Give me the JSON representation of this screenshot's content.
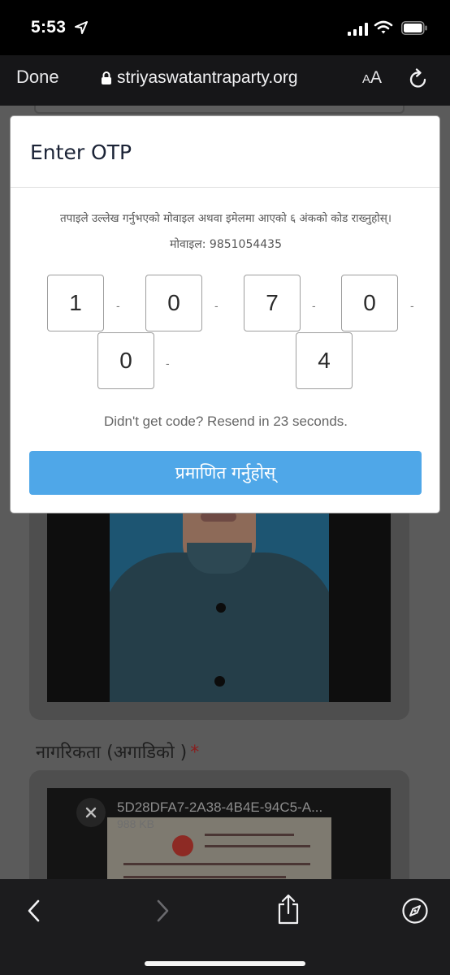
{
  "status_bar": {
    "time": "5:53"
  },
  "browser": {
    "done_label": "Done",
    "url": "striyaswatantraparty.org",
    "aa_small": "A",
    "aa_big": "A"
  },
  "modal": {
    "title": "Enter OTP",
    "description": "तपाइले उल्लेख गर्नुभएको मोवाइल अथवा इमेलमा आएको ६ अंकको कोड राख्नुहोस्।",
    "mobile_line": "मोवाइल: 9851054435",
    "otp_digits": [
      "1",
      "0",
      "7",
      "0",
      "0",
      "4"
    ],
    "separator": "-",
    "resend_text": "Didn't get code? Resend in 23 seconds.",
    "verify_button": "प्रमाणित गर्नुहोस्"
  },
  "page": {
    "citizenship_label": "नागरिकता (अगाडिको )",
    "required_mark": "*",
    "upload": {
      "file_name": "5D28DFA7-2A38-4B4E-94C5-A...",
      "file_size": "988 KB"
    }
  },
  "colors": {
    "verify_button": "#4fa7e8",
    "overlay_page": "#5b5b5b",
    "required_mark": "#8a1d1d"
  },
  "icons": {
    "status": [
      "location-arrow-icon",
      "signal-icon",
      "wifi-icon",
      "battery-icon"
    ],
    "browser": [
      "lock-icon",
      "reload-icon"
    ],
    "toolbar": [
      "back-icon",
      "forward-icon",
      "share-icon",
      "compass-icon"
    ]
  }
}
